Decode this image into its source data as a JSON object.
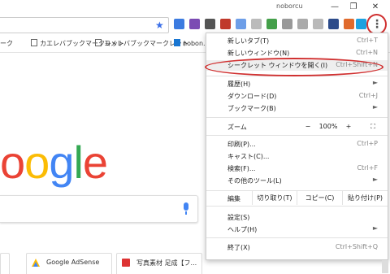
{
  "titlebar": {
    "user": "noborcu",
    "minimize": "—",
    "restore": "❐",
    "close": "✕"
  },
  "toolbar": {
    "menu_icon": "more-vert-icon"
  },
  "bookmarks": [
    {
      "label": "ーク"
    },
    {
      "label": "カエレバブックマークレット"
    },
    {
      "label": "ヨメレバブックマークレット"
    },
    {
      "label": "nobon..."
    }
  ],
  "logo": {
    "letters": [
      "o",
      "o",
      "g",
      "l",
      "e"
    ],
    "colors": [
      "#ea4335",
      "#fbbc05",
      "#4285f4",
      "#34a853",
      "#ea4335"
    ]
  },
  "tiles": [
    {
      "label": ""
    },
    {
      "label": "Google AdSense"
    },
    {
      "label": "写真素材 足成【フ..."
    }
  ],
  "menu": {
    "new_tab": {
      "label": "新しいタブ(T)",
      "shortcut": "Ctrl+T"
    },
    "new_window": {
      "label": "新しいウィンドウ(N)",
      "shortcut": "Ctrl+N"
    },
    "incognito": {
      "label": "シークレット ウィンドウを開く(I)",
      "shortcut": "Ctrl+Shift+N"
    },
    "history": {
      "label": "履歴(H)",
      "arrow": "►"
    },
    "downloads": {
      "label": "ダウンロード(D)",
      "shortcut": "Ctrl+J"
    },
    "bookmarks": {
      "label": "ブックマーク(B)",
      "arrow": "►"
    },
    "zoom": {
      "label": "ズーム",
      "minus": "−",
      "value": "100%",
      "plus": "+",
      "fullscreen": "⛶"
    },
    "print": {
      "label": "印刷(P)...",
      "shortcut": "Ctrl+P"
    },
    "cast": {
      "label": "キャスト(C)..."
    },
    "find": {
      "label": "検索(F)...",
      "shortcut": "Ctrl+F"
    },
    "more_tools": {
      "label": "その他のツール(L)",
      "arrow": "►"
    },
    "edit": {
      "label": "編集",
      "cut": "切り取り(T)",
      "copy": "コピー(C)",
      "paste": "貼り付け(P)"
    },
    "settings": {
      "label": "設定(S)"
    },
    "help": {
      "label": "ヘルプ(H)",
      "arrow": "►"
    },
    "exit": {
      "label": "終了(X)",
      "shortcut": "Ctrl+Shift+Q"
    }
  },
  "colors": {
    "highlight_ring": "#d03030",
    "accent_blue": "#4285f4"
  }
}
